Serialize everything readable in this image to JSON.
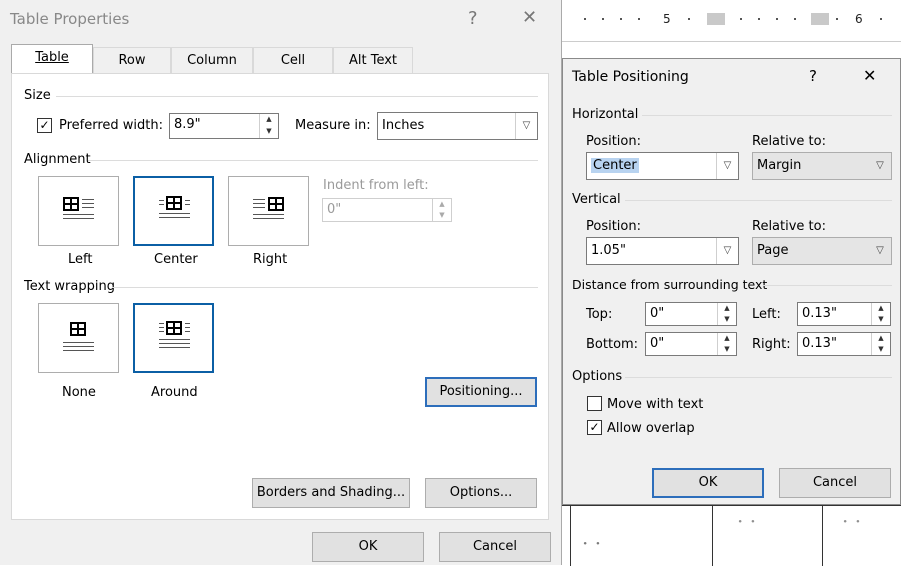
{
  "table_properties": {
    "title": "Table Properties",
    "help": "?",
    "close": "✕",
    "tabs": [
      "Table",
      "Row",
      "Column",
      "Cell",
      "Alt Text"
    ],
    "size": {
      "label": "Size",
      "preferred_width_label": "Preferred width:",
      "preferred_width_checked": true,
      "preferred_width_value": "8.9\"",
      "measure_in_label": "Measure in:",
      "measure_in_value": "Inches"
    },
    "alignment": {
      "label": "Alignment",
      "options": [
        "Left",
        "Center",
        "Right"
      ],
      "selected": "Center",
      "indent_label": "Indent from left:",
      "indent_value": "0\""
    },
    "text_wrapping": {
      "label": "Text wrapping",
      "options": [
        "None",
        "Around"
      ],
      "selected": "Around"
    },
    "positioning_button": "Positioning...",
    "borders_button": "Borders and Shading...",
    "options_button": "Options...",
    "ok": "OK",
    "cancel": "Cancel"
  },
  "table_positioning": {
    "title": "Table Positioning",
    "help": "?",
    "close": "✕",
    "horizontal": {
      "label": "Horizontal",
      "position_label": "Position:",
      "position_value": "Center",
      "relative_label": "Relative to:",
      "relative_value": "Margin"
    },
    "vertical": {
      "label": "Vertical",
      "position_label": "Position:",
      "position_value": "1.05\"",
      "relative_label": "Relative to:",
      "relative_value": "Page"
    },
    "distance": {
      "label": "Distance from surrounding text",
      "top_label": "Top:",
      "top_value": "0\"",
      "bottom_label": "Bottom:",
      "bottom_value": "0\"",
      "left_label": "Left:",
      "left_value": "0.13\"",
      "right_label": "Right:",
      "right_value": "0.13\""
    },
    "options": {
      "label": "Options",
      "move_with_text": "Move with text",
      "move_with_text_checked": false,
      "allow_overlap": "Allow overlap",
      "allow_overlap_checked": true
    },
    "ok": "OK",
    "cancel": "Cancel"
  },
  "ruler": {
    "numbers": [
      "5",
      "6"
    ]
  }
}
